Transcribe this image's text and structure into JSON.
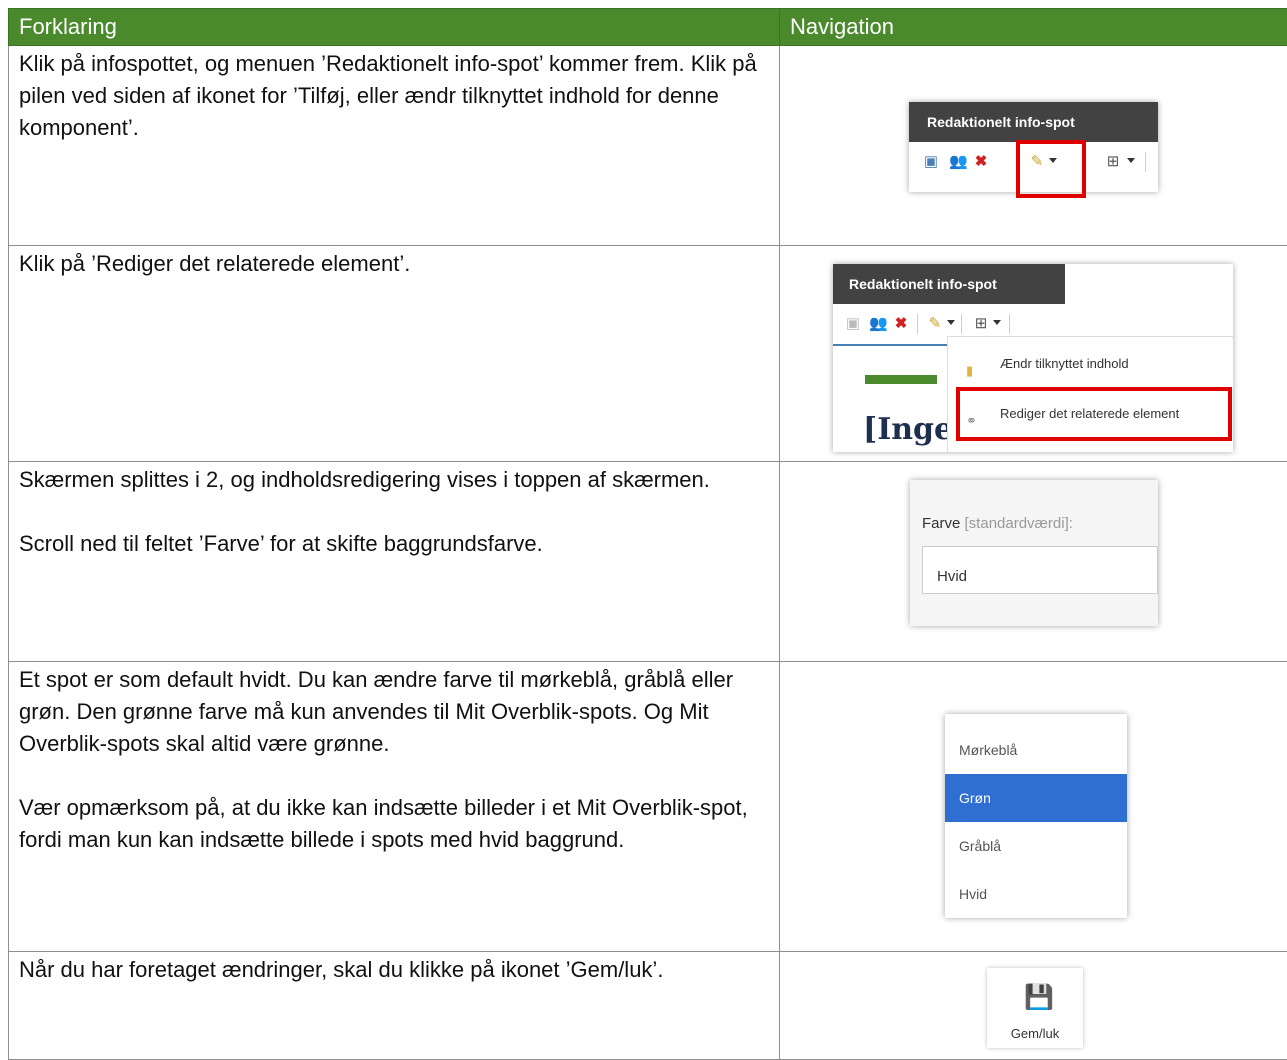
{
  "table": {
    "headers": {
      "explanation": "Forklaring",
      "navigation": "Navigation"
    },
    "rows": [
      {
        "text": "Klik på infospottet, og menuen ’Redaktionelt info-spot’ kommer frem. Klik på pilen ved siden af ikonet for ’Tilføj, eller ændr tilknyttet indhold for denne komponent’."
      },
      {
        "text": "Klik på ’Rediger det relaterede element’."
      },
      {
        "text1": "Skærmen splittes i 2, og indholdsredigering vises i toppen af skærmen.",
        "text2": "Scroll ned til feltet ’Farve’ for at skifte baggrundsfarve."
      },
      {
        "text1": "Et spot er som default hvidt. Du kan ændre farve til mørkeblå, gråblå eller grøn. Den grønne farve må kun anvendes til Mit Overblik-spots. Og Mit Overblik-spots skal altid være grønne.",
        "text2": "Vær opmærksom på, at du ikke kan indsætte billeder i et Mit Overblik-spot, fordi man kun kan indsætte billede i spots med hvid baggrund."
      },
      {
        "text": "Når du har foretaget ændringer, skal du klikke på ikonet ’Gem/luk’."
      }
    ]
  },
  "shots": {
    "infospot_title": "Redaktionelt info-spot",
    "menu": {
      "item1": "Ændr tilknyttet indhold",
      "item2": "Rediger det relaterede element",
      "partial_heading": "[Inge"
    },
    "field": {
      "label": "Farve",
      "hint": "[standardværdi]:",
      "value": "Hvid"
    },
    "dropdown": [
      "Mørkeblå",
      "Grøn",
      "Gråblå",
      "Hvid"
    ],
    "dropdown_selected": "Grøn",
    "save_label": "Gem/luk"
  },
  "colors": {
    "header_bg": "#4a8a2c",
    "highlight": "#e00000",
    "selected": "#2f6fd1"
  }
}
